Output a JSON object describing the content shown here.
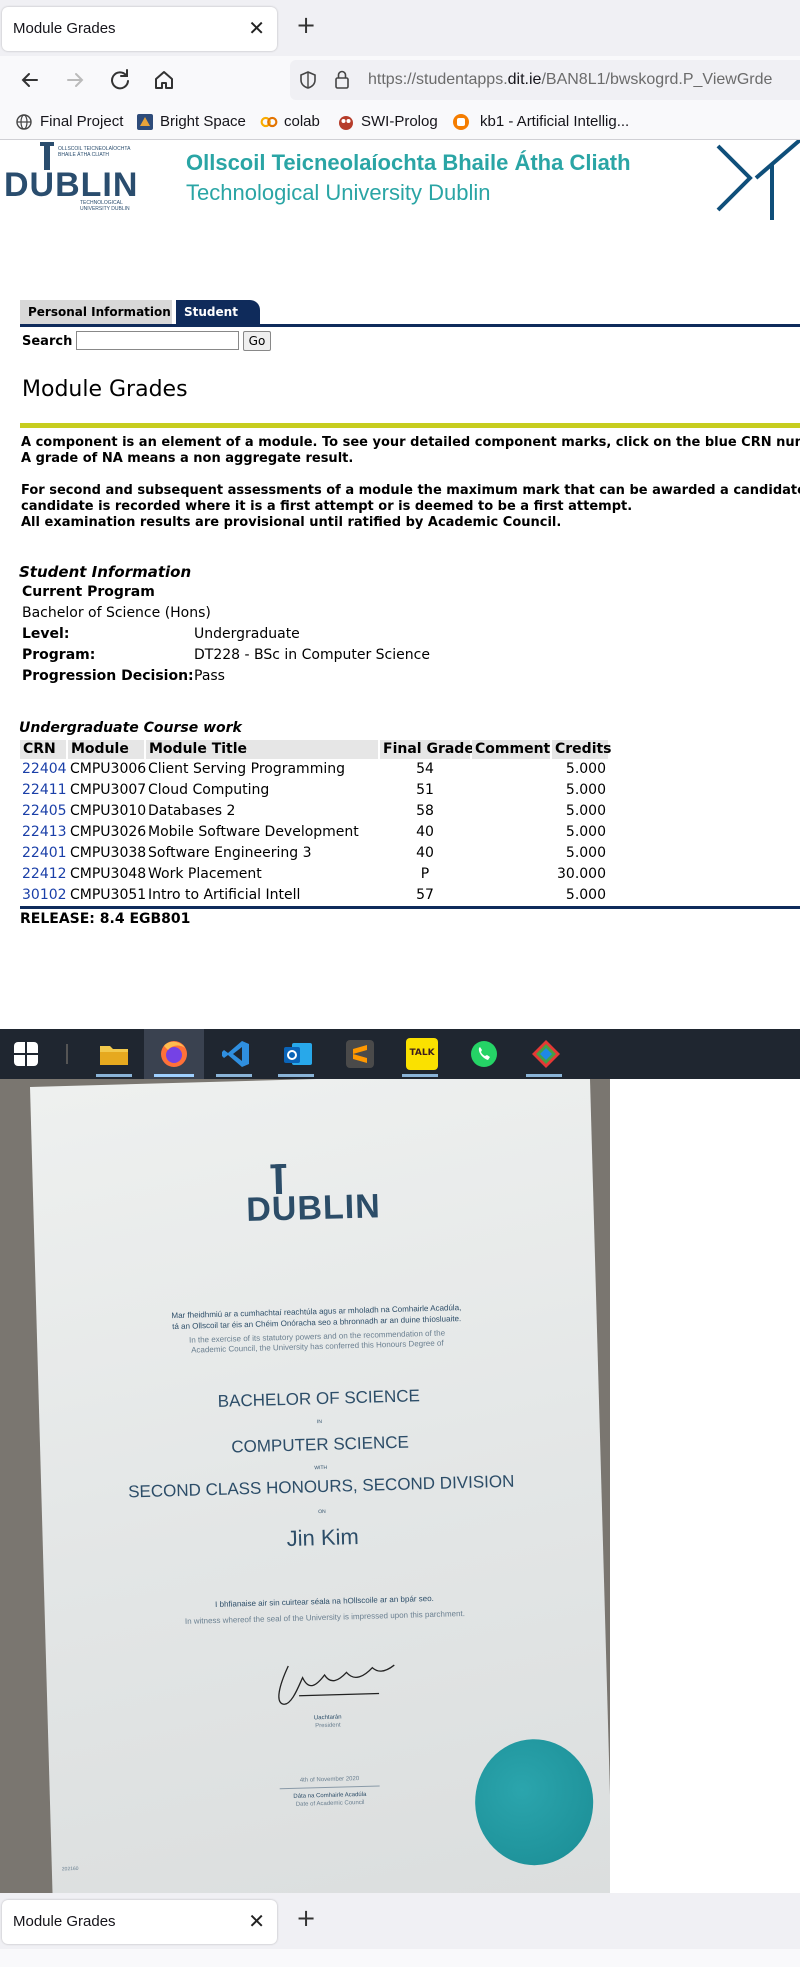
{
  "browser": {
    "tab_title": "Module Grades",
    "url_prefix": "https://studentapps.",
    "url_domain": "dit.ie",
    "url_rest": "/BAN8L1/bwskogrd.P_ViewGrde",
    "bookmarks": [
      "Final Project",
      "Bright Space",
      "colab",
      "SWI-Prolog",
      "kb1 - Artificial Intellig..."
    ]
  },
  "header": {
    "logo_word": "DUBLIN",
    "logo_small_top": "OLLSCOIL TEICNEOLAÍOCHTA BHAILE ÁTHA CLIATH",
    "logo_small_bottom": "TECHNOLOGICAL UNIVERSITY DUBLIN",
    "irish_name": "Ollscoil Teicneolaíochta Bhaile Átha Cliath",
    "english_name": "Technological University Dublin"
  },
  "nav": {
    "tab_personal": "Personal Information",
    "tab_student": "Student",
    "search_label": "Search",
    "go_label": "Go"
  },
  "page": {
    "title": "Module Grades",
    "info_lines": [
      "A component is an element of a module. To see your detailed component marks, click on the blue CRN numb",
      "A grade of NA means a non aggregate result.",
      "For second and subsequent assessments of a module the maximum mark that can be awarded a candidate",
      "candidate is recorded where it is a first attempt or is deemed to be a first attempt.",
      "All examination results are provisional until ratified by Academic Council."
    ]
  },
  "student_info": {
    "heading": "Student Information",
    "current_program_label": "Current Program",
    "current_program_value": "Bachelor of Science (Hons)",
    "level_label": "Level:",
    "level_value": "Undergraduate",
    "program_label": "Program:",
    "program_value": "DT228 - BSc in Computer Science",
    "progression_label": "Progression Decision:",
    "progression_value": "Pass"
  },
  "coursework": {
    "heading": "Undergraduate Course work",
    "columns": [
      "CRN",
      "Module",
      "Module Title",
      "Final Grade",
      "Comment",
      "Credits"
    ],
    "rows": [
      {
        "crn": "22404",
        "module": "CMPU3006",
        "title": "Client Serving Programming",
        "grade": "54",
        "comment": "",
        "credits": "5.000"
      },
      {
        "crn": "22411",
        "module": "CMPU3007",
        "title": "Cloud Computing",
        "grade": "51",
        "comment": "",
        "credits": "5.000"
      },
      {
        "crn": "22405",
        "module": "CMPU3010",
        "title": "Databases 2",
        "grade": "58",
        "comment": "",
        "credits": "5.000"
      },
      {
        "crn": "22413",
        "module": "CMPU3026",
        "title": "Mobile Software Development",
        "grade": "40",
        "comment": "",
        "credits": "5.000"
      },
      {
        "crn": "22401",
        "module": "CMPU3038",
        "title": "Software Engineering 3",
        "grade": "40",
        "comment": "",
        "credits": "5.000"
      },
      {
        "crn": "22412",
        "module": "CMPU3048",
        "title": "Work Placement",
        "grade": "P",
        "comment": "",
        "credits": "30.000"
      },
      {
        "crn": "30102",
        "module": "CMPU3051",
        "title": "Intro to Artificial Intell",
        "grade": "57",
        "comment": "",
        "credits": "5.000"
      }
    ],
    "release": "RELEASE: 8.4 EGB801"
  },
  "taskbar": {
    "icons": [
      "windows-start-icon",
      "file-explorer-icon",
      "firefox-icon",
      "vscode-icon",
      "outlook-icon",
      "sublime-text-icon",
      "kakaotalk-icon",
      "whatsapp-icon",
      "app-icon"
    ],
    "kakao_label": "TALK"
  },
  "certificate": {
    "logo_word": "DUBLIN",
    "irish_line1": "Mar fheidhmiú ar a cumhachtaí reachtúla agus ar mholadh na Comhairle Acadúla,",
    "irish_line2": "tá an Ollscoil tar éis an Chéim Onóracha seo a bhronnadh ar an duine thíosluaite.",
    "english_line1": "In the exercise of its statutory powers and on the recommendation of the",
    "english_line2": "Academic Council, the University has conferred this Honours Degree of",
    "degree": "BACHELOR OF SCIENCE",
    "in": "IN",
    "subject": "COMPUTER SCIENCE",
    "with": "WITH",
    "classification": "SECOND CLASS HONOURS, SECOND DIVISION",
    "on": "ON",
    "name": "Jin Kim",
    "witness_irish": "I bhfianaise air sin cuirtear séala na hOllscoile ar an bpár seo.",
    "witness_english": "In witness whereof the seal of the University is impressed upon this parchment.",
    "president_irish": "Uachtarán",
    "president_english": "President",
    "date": "4th of November 2020",
    "date_label_irish": "Dáta na Comhairle Acadúla",
    "date_label_english": "Date of Academic Council",
    "serial": "202160"
  },
  "browser2": {
    "tab_title": "Module Grades"
  },
  "colors": {
    "navy": "#0f2b5b",
    "teal": "#2aa5a5",
    "crn_blue": "#1a3fa8",
    "accent_rule": "#c7cd1f"
  }
}
